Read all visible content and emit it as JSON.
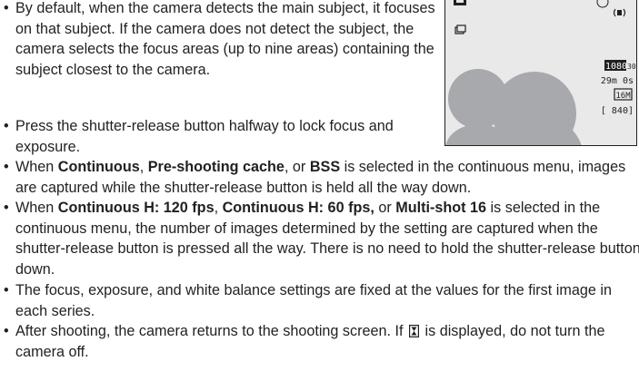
{
  "bullets": [
    "By default, when the camera detects the main subject, it focuses on that subject. If the camera does not detect the subject, the camera selects the focus areas (up to nine areas) containing the subject closest to the camera.",
    "Press the shutter-release button halfway to lock focus and exposure.",
    [
      "When ",
      "Continuous",
      ", ",
      "Pre-shooting cache",
      ", or ",
      "BSS",
      " is selected in the continuous menu, images are captured while the shutter-release button is held all the way down."
    ],
    [
      "When ",
      "Continuous H: 120 fps",
      ", ",
      "Continuous H: 60 fps,",
      " or ",
      "Multi-shot 16",
      " is selected in the continuous menu, the number of images determined by the setting are captured when the shutter-release button is pressed all the way. There is no need to hold the shutter-release button down."
    ],
    "The focus, exposure, and white balance settings are fixed at the values for the first image in each series.",
    [
      "After shooting, the camera returns to the shooting screen. If ",
      " is displayed, do not turn the camera off."
    ]
  ],
  "screen": {
    "movie_mode": "1080",
    "movie_fps": "30",
    "time_remaining": "29m 0s",
    "image_size": "16M",
    "exposures_remaining": "[ 840]"
  },
  "colors": {
    "text": "#231f20",
    "screen_bg": "#e9e9ea",
    "subject": "#a7a9ac"
  }
}
